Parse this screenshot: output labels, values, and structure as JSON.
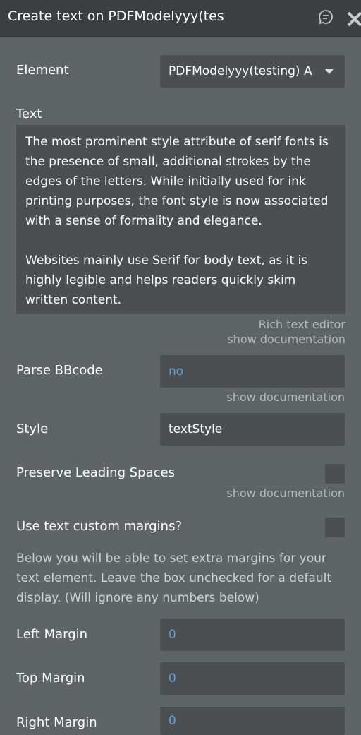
{
  "header": {
    "title": "Create text on PDFModelyyy(tes"
  },
  "element": {
    "label": "Element",
    "value": "PDFModelyyy(testing) A"
  },
  "text": {
    "label": "Text",
    "value": "The most prominent style attribute of serif fonts is the presence of small, additional strokes by the edges of the letters. While initially used for ink printing purposes, the font style is now associated with a sense of formality and elegance.\n\nWebsites mainly use Serif for body text, as it is highly legible and helps readers quickly skim written content.",
    "rich_editor": "Rich text editor",
    "show_doc": "show documentation"
  },
  "parse_bbcode": {
    "label": "Parse BBcode",
    "value": "no",
    "show_doc": "show documentation"
  },
  "style": {
    "label": "Style",
    "value": "textStyle"
  },
  "preserve_spaces": {
    "label": "Preserve Leading Spaces",
    "checked": false,
    "show_doc": "show documentation"
  },
  "custom_margins": {
    "label": "Use text custom margins?",
    "checked": false,
    "description": "Below you will be able to set extra margins for your text element. Leave the box unchecked for a default display. (Will ignore any numbers below)"
  },
  "left_margin": {
    "label": "Left Margin",
    "value": "0"
  },
  "top_margin": {
    "label": "Top Margin",
    "value": "0"
  },
  "right_margin": {
    "label": "Right Margin",
    "value": "0"
  },
  "colors": {
    "panel_bg": "#5f6467",
    "header_bg": "#3b3f42",
    "field_bg": "#4b4f52",
    "dynamic_value": "#5ea3de",
    "doc_link": "#b4b9bc"
  }
}
